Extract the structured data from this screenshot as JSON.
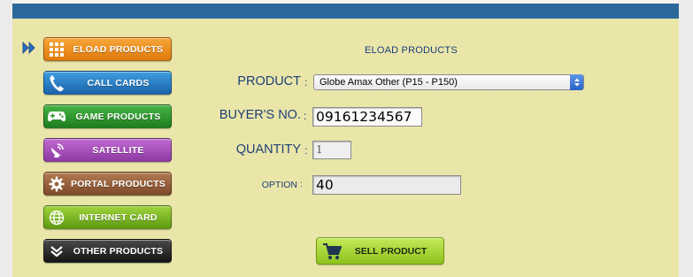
{
  "menu": {
    "items": [
      {
        "label": "ELOAD PRODUCTS",
        "icon": "grid-icon",
        "color": "#f08c1c"
      },
      {
        "label": "CALL CARDS",
        "icon": "phone-icon",
        "color": "#2a7fc8"
      },
      {
        "label": "GAME PRODUCTS",
        "icon": "gamepad-icon",
        "color": "#2f9a2f"
      },
      {
        "label": "SATELLITE",
        "icon": "satellite-dish-icon",
        "color": "#a850bc"
      },
      {
        "label": "PORTAL PRODUCTS",
        "icon": "gear-icon",
        "color": "#9a623c"
      },
      {
        "label": "INTERNET CARD",
        "icon": "globe-icon",
        "color": "#7cb826"
      },
      {
        "label": "OTHER PRODUCTS",
        "icon": "double-chevron-down-icon",
        "color": "#2a2a2a"
      }
    ]
  },
  "form": {
    "title": "ELOAD PRODUCTS",
    "product_label": "PRODUCT",
    "product_value": "Globe Amax Other (P15 - P150)",
    "buyer_label": "BUYER'S NO.",
    "buyer_value": "09161234567",
    "quantity_label": "QUANTITY",
    "quantity_value": "1",
    "option_label": "OPTION",
    "option_value": "40",
    "colon": ":"
  },
  "sell_button": {
    "label": "SELL PRODUCT",
    "icon": "shopping-cart-icon"
  },
  "colors": {
    "header": "#2c689c",
    "panel": "#eae6a9",
    "label_text": "#1d3f78"
  }
}
